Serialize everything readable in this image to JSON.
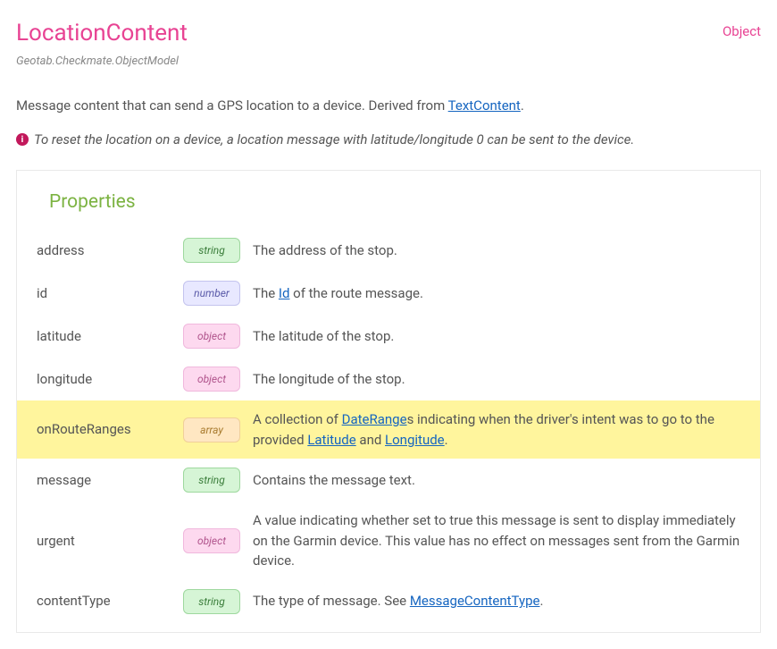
{
  "header": {
    "title": "LocationContent",
    "kind": "Object",
    "namespace": "Geotab.Checkmate.ObjectModel"
  },
  "summary": {
    "prefix": "Message content that can send a GPS location to a device. Derived from ",
    "link": "TextContent",
    "suffix": "."
  },
  "note": {
    "text": "To reset the location on a device, a location message with latitude/longitude 0 can be sent to the device."
  },
  "panel": {
    "title": "Properties"
  },
  "props": {
    "p0": {
      "name": "address",
      "type": "string",
      "desc": "The address of the stop."
    },
    "p1": {
      "name": "id",
      "type": "number",
      "d_a": "The ",
      "d_l1": "Id",
      "d_b": " of the route message."
    },
    "p2": {
      "name": "latitude",
      "type": "object",
      "desc": "The latitude of the stop."
    },
    "p3": {
      "name": "longitude",
      "type": "object",
      "desc": "The longitude of the stop."
    },
    "p4": {
      "name": "onRouteRanges",
      "type": "array",
      "d_a": "A collection of ",
      "d_l1": "DateRange",
      "d_b": "s indicating when the driver's intent was to go to the provided ",
      "d_l2": "Latitude",
      "d_c": " and ",
      "d_l3": "Longitude",
      "d_d": "."
    },
    "p5": {
      "name": "message",
      "type": "string",
      "desc": "Contains the message text."
    },
    "p6": {
      "name": "urgent",
      "type": "object",
      "desc": "A value indicating whether set to true this message is sent to display immediately on the Garmin device. This value has no effect on messages sent from the Garmin device."
    },
    "p7": {
      "name": "contentType",
      "type": "string",
      "d_a": "The type of message. See ",
      "d_l1": "MessageContentType",
      "d_b": "."
    }
  }
}
